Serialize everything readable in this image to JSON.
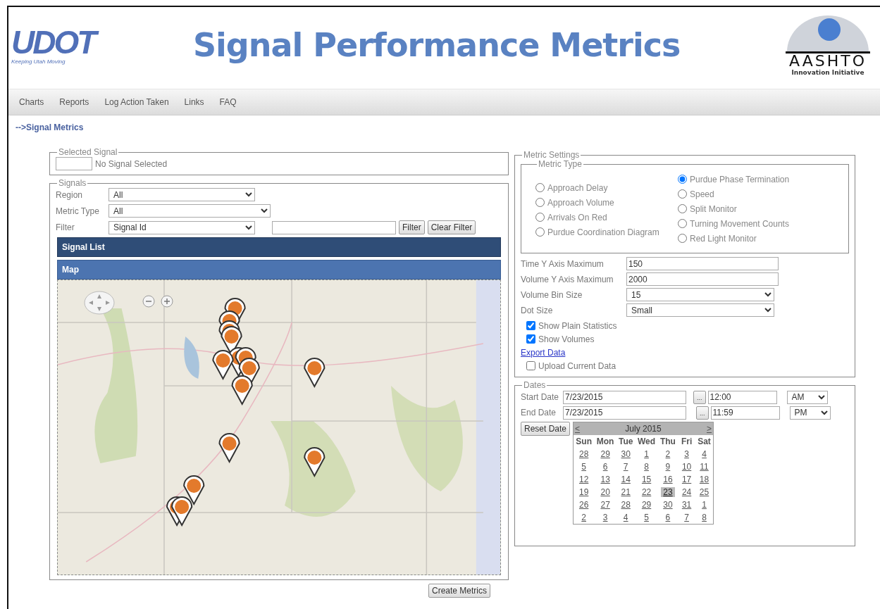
{
  "header": {
    "logo_left": {
      "text": "UDOT",
      "tagline": "Keeping Utah Moving"
    },
    "title": "Signal Performance Metrics",
    "logo_right": {
      "text": "AASHTO",
      "subtitle": "Innovation Initiative"
    }
  },
  "nav": [
    "Charts",
    "Reports",
    "Log Action Taken",
    "Links",
    "FAQ"
  ],
  "breadcrumb": "-->Signal Metrics",
  "selected_signal": {
    "legend": "Selected Signal",
    "text": "No Signal Selected"
  },
  "signals": {
    "legend": "Signals",
    "fields": [
      {
        "label": "Region",
        "value": "All"
      },
      {
        "label": "Metric Type",
        "value": "All"
      },
      {
        "label": "Filter",
        "value": "Signal Id"
      }
    ],
    "filter_buttons": [
      "Filter",
      "Clear Filter"
    ],
    "signal_list_title": "Signal List",
    "map_title": "Map"
  },
  "create_button": "Create Metrics",
  "metric_settings": {
    "legend": "Metric Settings",
    "metric_type": {
      "legend": "Metric Type",
      "columns": [
        [
          {
            "label": "Approach Delay",
            "selected": false
          },
          {
            "label": "Approach Volume",
            "selected": false
          },
          {
            "label": "Arrivals On Red",
            "selected": false
          },
          {
            "label": "Purdue Coordination Diagram",
            "selected": false
          }
        ],
        [
          {
            "label": "Purdue Phase Termination",
            "selected": true
          },
          {
            "label": "Speed",
            "selected": false
          },
          {
            "label": "Split Monitor",
            "selected": false
          },
          {
            "label": "Turning Movement Counts",
            "selected": false
          },
          {
            "label": "Red Light Monitor",
            "selected": false
          }
        ]
      ]
    },
    "fields": [
      {
        "kind": "text",
        "label": "Time Y Axis Maximum",
        "value": "150"
      },
      {
        "kind": "text",
        "label": "Volume Y Axis Maximum",
        "value": "2000"
      },
      {
        "kind": "select",
        "label": "Volume Bin Size",
        "value": "15"
      },
      {
        "kind": "select",
        "label": "Dot Size",
        "value": "Small"
      }
    ],
    "options": [
      {
        "kind": "checkbox",
        "label": "Show Plain Statistics",
        "checked": true
      },
      {
        "kind": "checkbox",
        "label": "Show Volumes",
        "checked": true
      },
      {
        "kind": "link",
        "label": "Export Data"
      },
      {
        "kind": "checkbox",
        "label": "Upload Current Data",
        "checked": false
      }
    ]
  },
  "dates": {
    "legend": "Dates",
    "rows": [
      {
        "label": "Start Date",
        "date": "7/23/2015",
        "picker": "...",
        "time": "12:00",
        "meridiem": "AM"
      },
      {
        "label": "End Date",
        "date": "7/23/2015",
        "picker": "...",
        "time": "11:59",
        "meridiem": "PM"
      }
    ],
    "reset_button": "Reset Date",
    "calendar": {
      "prev": "<",
      "month": "July 2015",
      "next": ">",
      "weekdays": [
        "Sun",
        "Mon",
        "Tue",
        "Wed",
        "Thu",
        "Fri",
        "Sat"
      ],
      "weeks": [
        [
          {
            "day": "28",
            "selected": false
          },
          {
            "day": "29",
            "selected": false
          },
          {
            "day": "30",
            "selected": false
          },
          {
            "day": "1",
            "selected": false
          },
          {
            "day": "2",
            "selected": false
          },
          {
            "day": "3",
            "selected": false
          },
          {
            "day": "4",
            "selected": false
          }
        ],
        [
          {
            "day": "5",
            "selected": false
          },
          {
            "day": "6",
            "selected": false
          },
          {
            "day": "7",
            "selected": false
          },
          {
            "day": "8",
            "selected": false
          },
          {
            "day": "9",
            "selected": false
          },
          {
            "day": "10",
            "selected": false
          },
          {
            "day": "11",
            "selected": false
          }
        ],
        [
          {
            "day": "12",
            "selected": false
          },
          {
            "day": "13",
            "selected": false
          },
          {
            "day": "14",
            "selected": false
          },
          {
            "day": "15",
            "selected": false
          },
          {
            "day": "16",
            "selected": false
          },
          {
            "day": "17",
            "selected": false
          },
          {
            "day": "18",
            "selected": false
          }
        ],
        [
          {
            "day": "19",
            "selected": false
          },
          {
            "day": "20",
            "selected": false
          },
          {
            "day": "21",
            "selected": false
          },
          {
            "day": "22",
            "selected": false
          },
          {
            "day": "23",
            "selected": true
          },
          {
            "day": "24",
            "selected": false
          },
          {
            "day": "25",
            "selected": false
          }
        ],
        [
          {
            "day": "26",
            "selected": false
          },
          {
            "day": "27",
            "selected": false
          },
          {
            "day": "28",
            "selected": false
          },
          {
            "day": "29",
            "selected": false
          },
          {
            "day": "30",
            "selected": false
          },
          {
            "day": "31",
            "selected": false
          },
          {
            "day": "1",
            "selected": false
          }
        ],
        [
          {
            "day": "2",
            "selected": false
          },
          {
            "day": "3",
            "selected": false
          },
          {
            "day": "4",
            "selected": false
          },
          {
            "day": "5",
            "selected": false
          },
          {
            "day": "6",
            "selected": false
          },
          {
            "day": "7",
            "selected": false
          },
          {
            "day": "8",
            "selected": false
          }
        ]
      ]
    }
  }
}
